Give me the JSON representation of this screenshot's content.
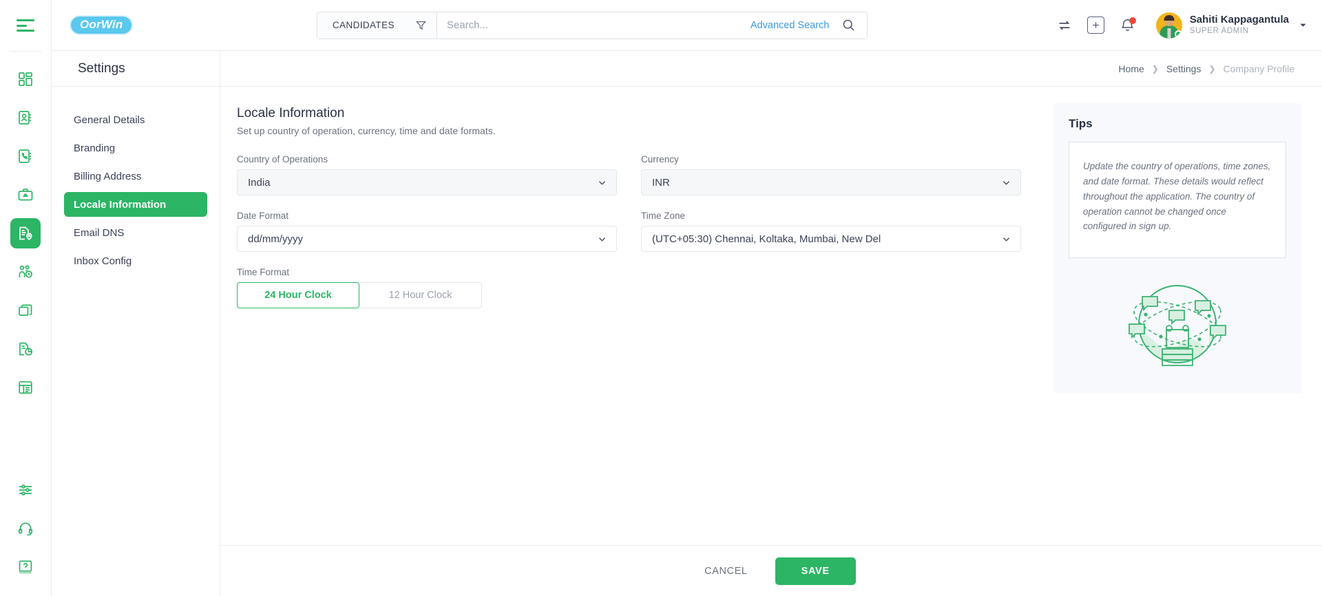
{
  "colors": {
    "brand_green": "#2cb565",
    "logo_blue": "#5bc8ee",
    "link_blue": "#3d9ae0",
    "notification_red": "#f2453d",
    "muted_text": "#6b7280"
  },
  "rail": {
    "menu_icon": "hamburger-menu-icon",
    "items": [
      {
        "name": "dashboard",
        "icon": "dashboard-grid-icon",
        "active": false
      },
      {
        "name": "contacts",
        "icon": "contact-card-icon",
        "active": false
      },
      {
        "name": "calls",
        "icon": "phone-book-icon",
        "active": false
      },
      {
        "name": "jobs",
        "icon": "briefcase-icon",
        "active": false
      },
      {
        "name": "placements",
        "icon": "document-location-icon",
        "active": true
      },
      {
        "name": "timesheets",
        "icon": "people-clock-icon",
        "active": false
      },
      {
        "name": "layers",
        "icon": "layers-copy-icon",
        "active": false
      },
      {
        "name": "analytics",
        "icon": "document-chart-icon",
        "active": false
      },
      {
        "name": "reports",
        "icon": "report-table-icon",
        "active": false
      }
    ],
    "bottom_items": [
      {
        "name": "settings",
        "icon": "sliders-settings-icon"
      },
      {
        "name": "support",
        "icon": "headset-support-icon"
      },
      {
        "name": "help",
        "icon": "help-book-icon"
      }
    ]
  },
  "header": {
    "logo_text": "OorWin",
    "entity_filter": {
      "label": "CANDIDATES",
      "icon": "funnel-filter-icon"
    },
    "search": {
      "placeholder": "Search...",
      "value": ""
    },
    "advanced_search_label": "Advanced Search",
    "search_icon": "search-magnifier-icon",
    "actions": [
      {
        "name": "switch-account",
        "icon": "swap-arrows-icon"
      },
      {
        "name": "quick-add",
        "icon": "plus-box-icon"
      },
      {
        "name": "notifications",
        "icon": "bell-icon",
        "has_badge": true
      }
    ],
    "user": {
      "name": "Sahiti Kappagantula",
      "role": "SUPER ADMIN",
      "status": "online"
    }
  },
  "page": {
    "title": "Settings",
    "breadcrumb": [
      {
        "label": "Home",
        "current": false
      },
      {
        "label": "Settings",
        "current": false
      },
      {
        "label": "Company Profile",
        "current": true
      }
    ]
  },
  "settings_nav": {
    "items": [
      {
        "label": "General Details",
        "active": false
      },
      {
        "label": "Branding",
        "active": false
      },
      {
        "label": "Billing Address",
        "active": false
      },
      {
        "label": "Locale Information",
        "active": true
      },
      {
        "label": "Email DNS",
        "active": false
      },
      {
        "label": "Inbox Config",
        "active": false
      }
    ]
  },
  "form": {
    "title": "Locale Information",
    "subtitle": "Set up country of operation, currency, time and date formats.",
    "fields": [
      {
        "label": "Country of Operations",
        "value": "India",
        "disabled": true
      },
      {
        "label": "Currency",
        "value": "INR",
        "disabled": true
      },
      {
        "label": "Date Format",
        "value": "dd/mm/yyyy",
        "disabled": false
      },
      {
        "label": "Time Zone",
        "value": "(UTC+05:30) Chennai, Koltaka, Mumbai, New Del",
        "disabled": false
      }
    ],
    "time_format": {
      "label": "Time Format",
      "options": [
        {
          "label": "24 Hour Clock",
          "selected": true
        },
        {
          "label": "12 Hour Clock",
          "selected": false
        }
      ]
    }
  },
  "tips": {
    "title": "Tips",
    "text": "Update the country of operations, time zones, and date format. These details would reflect throughout the application. The country of operation cannot be changed once configured in sign up.",
    "illustration": "globe-orbit-illustration"
  },
  "footer": {
    "cancel_label": "CANCEL",
    "save_label": "SAVE"
  }
}
